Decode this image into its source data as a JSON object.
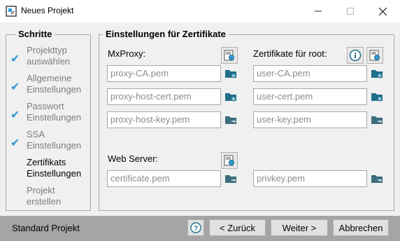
{
  "window": {
    "title": "Neues Projekt"
  },
  "steps": {
    "title": "Schritte",
    "items": [
      {
        "label": "Projekttyp\nauswählen",
        "done": true
      },
      {
        "label": "Allgemeine\nEinstellungen",
        "done": true
      },
      {
        "label": "Passwort\nEinstellungen",
        "done": true
      },
      {
        "label": "SSA\nEinstellungen",
        "done": true
      },
      {
        "label": "Zertifikats\nEinstellungen",
        "done": false,
        "current": true
      },
      {
        "label": "Projekt\nerstellen",
        "done": false
      }
    ]
  },
  "certs": {
    "title": "Einstellungen für Zertifikate",
    "mxproxy_label": "MxProxy:",
    "root_label": "Zertifikate für root:",
    "webserver_label": "Web Server:",
    "fields": {
      "proxy_ca": "proxy-CA.pem",
      "proxy_host_cert": "proxy-host-cert.pem",
      "proxy_host_key": "proxy-host-key.pem",
      "user_ca": "user-CA.pem",
      "user_cert": "user-cert.pem",
      "user_key": "user-key.pem",
      "certificate": "certificate.pem",
      "privkey": "privkey.pem"
    }
  },
  "footer": {
    "label": "Standard Projekt",
    "back": "< Zurück",
    "next": "Weiter >",
    "cancel": "Abbrechen"
  },
  "colors": {
    "accent": "#2e9ad6",
    "folder": "#1f6f8b",
    "footer_bg": "#a5a5a5"
  }
}
